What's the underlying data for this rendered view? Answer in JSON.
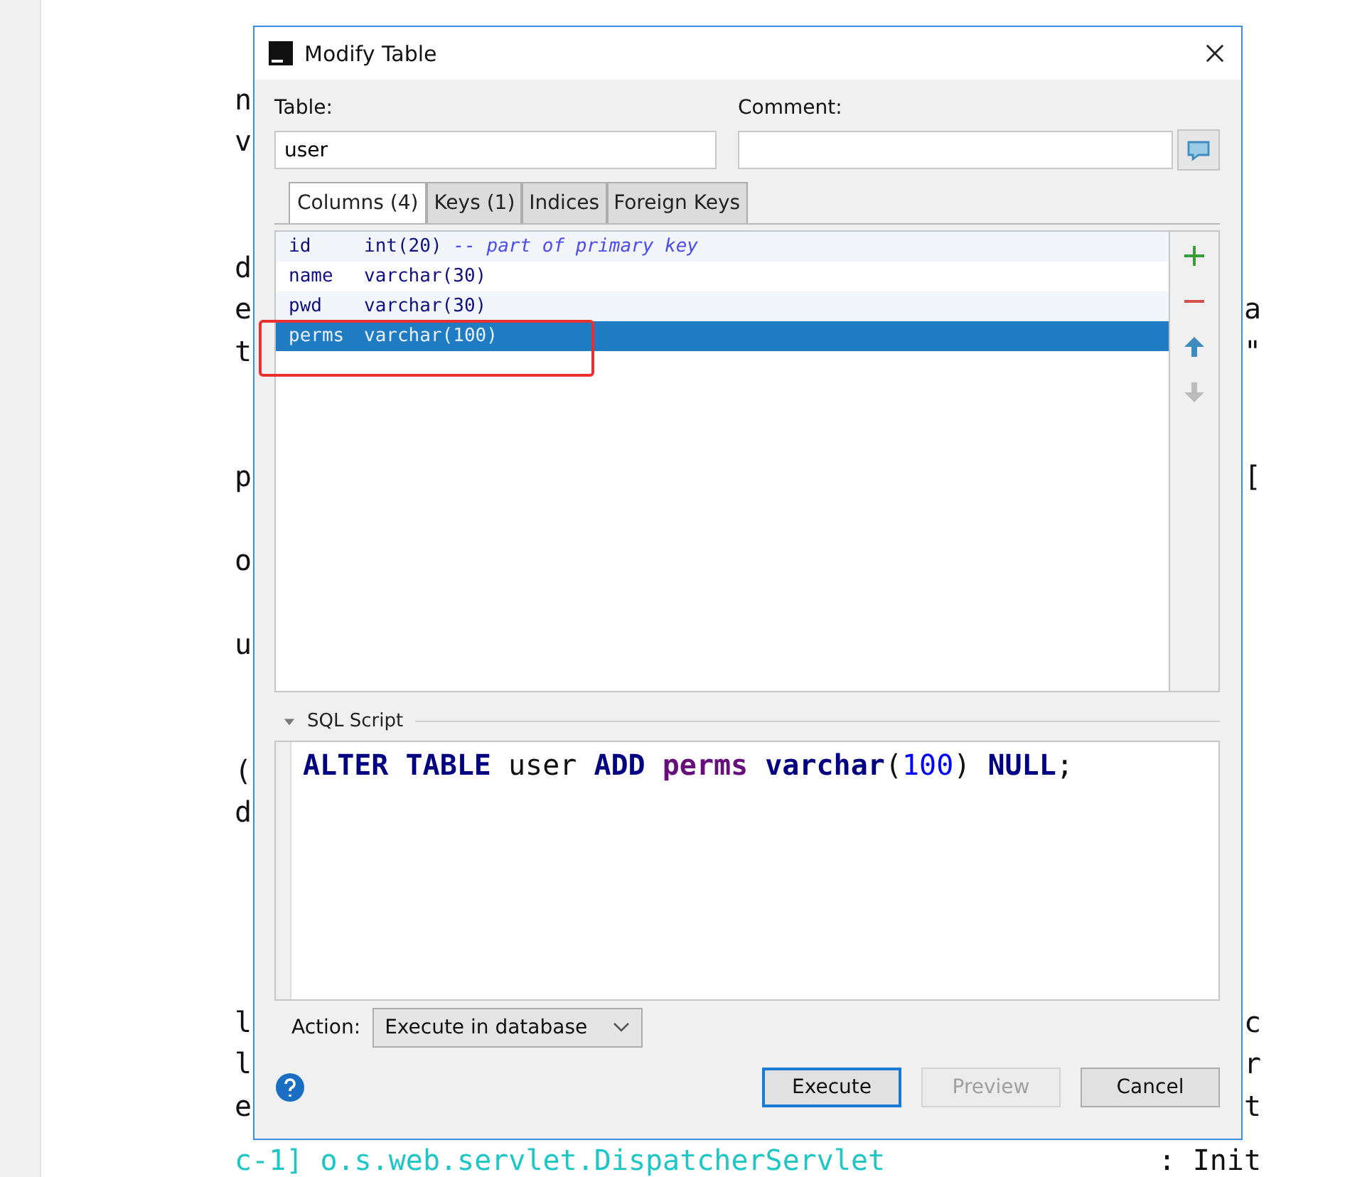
{
  "background_editor": {
    "lines": [
      {
        "kind": "code",
        "left": "n"
      },
      {
        "kind": "code",
        "left": "v"
      },
      {
        "kind": "blank"
      },
      {
        "kind": "blank"
      },
      {
        "kind": "code",
        "left": "d"
      },
      {
        "kind": "code",
        "left": "e",
        "right": "a"
      },
      {
        "kind": "code",
        "left": "t",
        "right": "\""
      },
      {
        "kind": "blank"
      },
      {
        "kind": "blank"
      },
      {
        "kind": "code",
        "left": "p",
        "right": "["
      },
      {
        "kind": "blank"
      },
      {
        "kind": "code",
        "left": "o"
      },
      {
        "kind": "blank"
      },
      {
        "kind": "code",
        "left": "u"
      },
      {
        "kind": "blank"
      },
      {
        "kind": "blank"
      },
      {
        "kind": "code",
        "left": "("
      },
      {
        "kind": "code",
        "left": "d"
      },
      {
        "kind": "blank"
      },
      {
        "kind": "blank"
      },
      {
        "kind": "blank"
      },
      {
        "kind": "blank"
      },
      {
        "kind": "code",
        "left": "l",
        "right": "c"
      },
      {
        "kind": "code",
        "left": "l",
        "right": "r"
      },
      {
        "kind": "code",
        "left": "e",
        "right": "t"
      }
    ],
    "log_line": "c-1] o.s.web.servlet.DispatcherServlet",
    "log_tail": ": Init"
  },
  "window": {
    "title": "Modify Table"
  },
  "table_label": "Table:",
  "table_value": "user",
  "comment_label": "Comment:",
  "tabs": [
    {
      "label": "Columns (4)",
      "selected": true
    },
    {
      "label": "Keys (1)",
      "selected": false
    },
    {
      "label": "Indices",
      "selected": false
    },
    {
      "label": "Foreign Keys",
      "selected": false
    }
  ],
  "columns": [
    {
      "name": "id",
      "type": "int(20)",
      "comment": "-- part of primary key",
      "selected": false
    },
    {
      "name": "name",
      "type": "varchar(30)",
      "selected": false
    },
    {
      "name": "pwd",
      "type": "varchar(30)",
      "selected": false
    },
    {
      "name": "perms",
      "type": "varchar(100)",
      "selected": true
    }
  ],
  "toolbar": [
    {
      "kind": "add",
      "disabled": false
    },
    {
      "kind": "remove",
      "disabled": false
    },
    {
      "kind": "up",
      "disabled": false
    },
    {
      "kind": "down",
      "disabled": true
    }
  ],
  "sql_section": {
    "title": "SQL Script",
    "expanded": true,
    "tokens": [
      {
        "text": "ALTER ",
        "kind": "keyword"
      },
      {
        "text": "TABLE ",
        "kind": "keyword"
      },
      {
        "text": "user ",
        "kind": "plain"
      },
      {
        "text": "ADD ",
        "kind": "keyword"
      },
      {
        "text": "perms ",
        "kind": "column"
      },
      {
        "text": "varchar",
        "kind": "keyword"
      },
      {
        "text": "(",
        "kind": "plain"
      },
      {
        "text": "100",
        "kind": "number"
      },
      {
        "text": ") ",
        "kind": "plain"
      },
      {
        "text": "NULL",
        "kind": "keyword"
      },
      {
        "text": ";",
        "kind": "plain"
      }
    ]
  },
  "action_label": "Action:",
  "action_value": "Execute in database",
  "buttons": [
    {
      "label": "Execute",
      "default": true,
      "disabled": false
    },
    {
      "label": "Preview",
      "default": false,
      "disabled": true
    },
    {
      "label": "Cancel",
      "default": false,
      "disabled": false
    }
  ]
}
